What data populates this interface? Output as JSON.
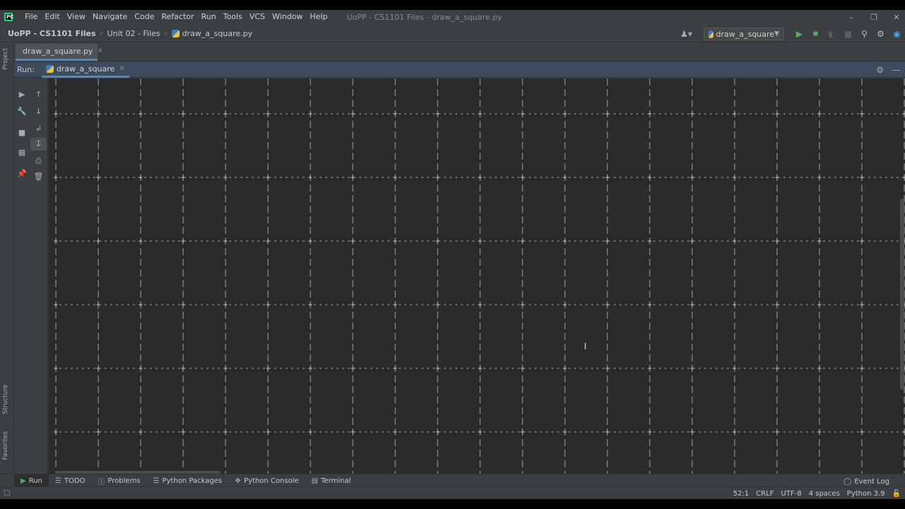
{
  "menu": {
    "items": [
      "File",
      "Edit",
      "View",
      "Navigate",
      "Code",
      "Refactor",
      "Run",
      "Tools",
      "VCS",
      "Window",
      "Help"
    ],
    "window_title": "UoPP - CS1101 Files - draw_a_square.py"
  },
  "navbar": {
    "project": "UoPP - CS1101 Files",
    "folder": "Unit 02 - Files",
    "file": "draw_a_square.py",
    "run_config": "draw_a_square"
  },
  "editor": {
    "tab": "draw_a_square.py"
  },
  "left_stripe": {
    "project": "Project",
    "structure": "Structure",
    "favorites": "Favorites"
  },
  "run_window": {
    "label": "Run:",
    "tab": "draw_a_square"
  },
  "bottom_bar": {
    "run": "Run",
    "todo": "TODO",
    "problems": "Problems",
    "python_packages": "Python Packages",
    "python_console": "Python Console",
    "terminal": "Terminal",
    "event_log": "Event Log"
  },
  "status": {
    "position": "52:1",
    "line_sep": "CRLF",
    "encoding": "UTF-8",
    "indent": "4 spaces",
    "interpreter": "Python 3.9"
  },
  "colors": {
    "accent": "#4a88c7",
    "run_green": "#59a869",
    "console_bg": "#2b2b2b",
    "grid_char": "#c7c7c7"
  }
}
